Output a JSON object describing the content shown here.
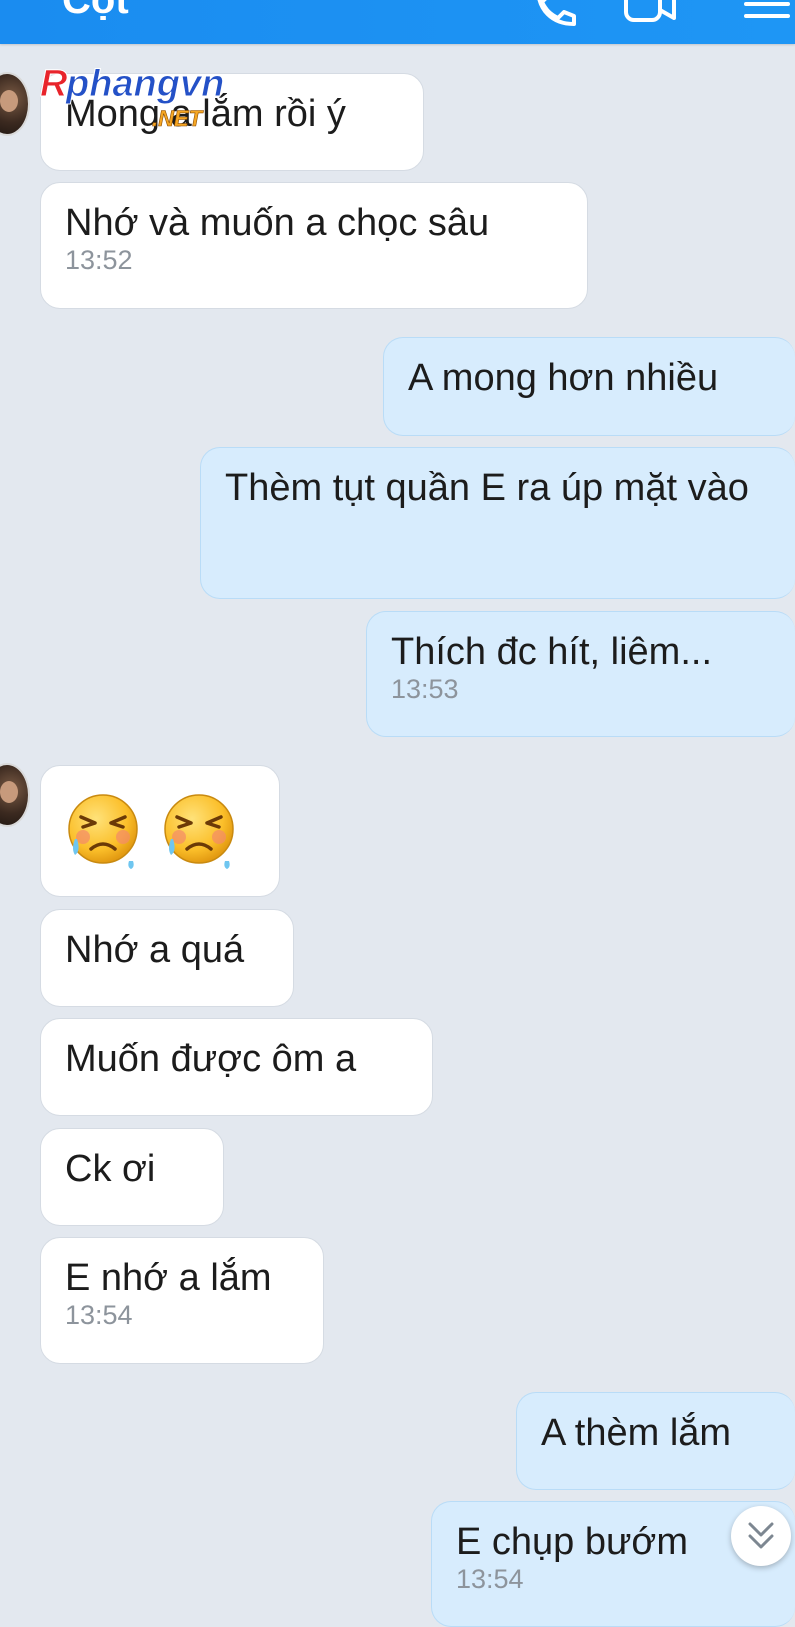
{
  "header": {
    "title": "Cột",
    "background_color": "#1a8cf0",
    "icons": [
      "call-icon",
      "video-call-icon",
      "menu-icon"
    ]
  },
  "watermark": {
    "brand": "Rphangvn",
    "suffix": ".NET"
  },
  "messages": [
    {
      "side": "in",
      "text": "Mong a lắm rồi ý",
      "time": ""
    },
    {
      "side": "in",
      "text": "Nhớ và muốn a chọc sâu",
      "time": "13:52"
    },
    {
      "side": "out",
      "text": "A mong hơn nhiều",
      "time": ""
    },
    {
      "side": "out",
      "text": "Thèm tụt quần E ra úp mặt vào",
      "time": ""
    },
    {
      "side": "out",
      "text": "Thích đc hít, liêm...",
      "time": "13:53"
    },
    {
      "side": "in",
      "emoji": [
        "crying-angry-face-emoji",
        "crying-angry-face-emoji"
      ],
      "time": ""
    },
    {
      "side": "in",
      "text": "Nhớ a quá",
      "time": ""
    },
    {
      "side": "in",
      "text": "Muốn được ôm a",
      "time": ""
    },
    {
      "side": "in",
      "text": "Ck ơi",
      "time": ""
    },
    {
      "side": "in",
      "text": "E nhớ a lắm",
      "time": "13:54"
    },
    {
      "side": "out",
      "text": "A thèm lắm",
      "time": ""
    },
    {
      "side": "out",
      "text": "E chụp bướm",
      "time": "13:54"
    }
  ],
  "colors": {
    "chat_background": "#e3e8ef",
    "incoming_bubble": "#ffffff",
    "outgoing_bubble": "#d7ecfd",
    "timestamp": "#8d949c"
  },
  "scroll_button": {
    "icon": "double-chevron-down-icon"
  }
}
